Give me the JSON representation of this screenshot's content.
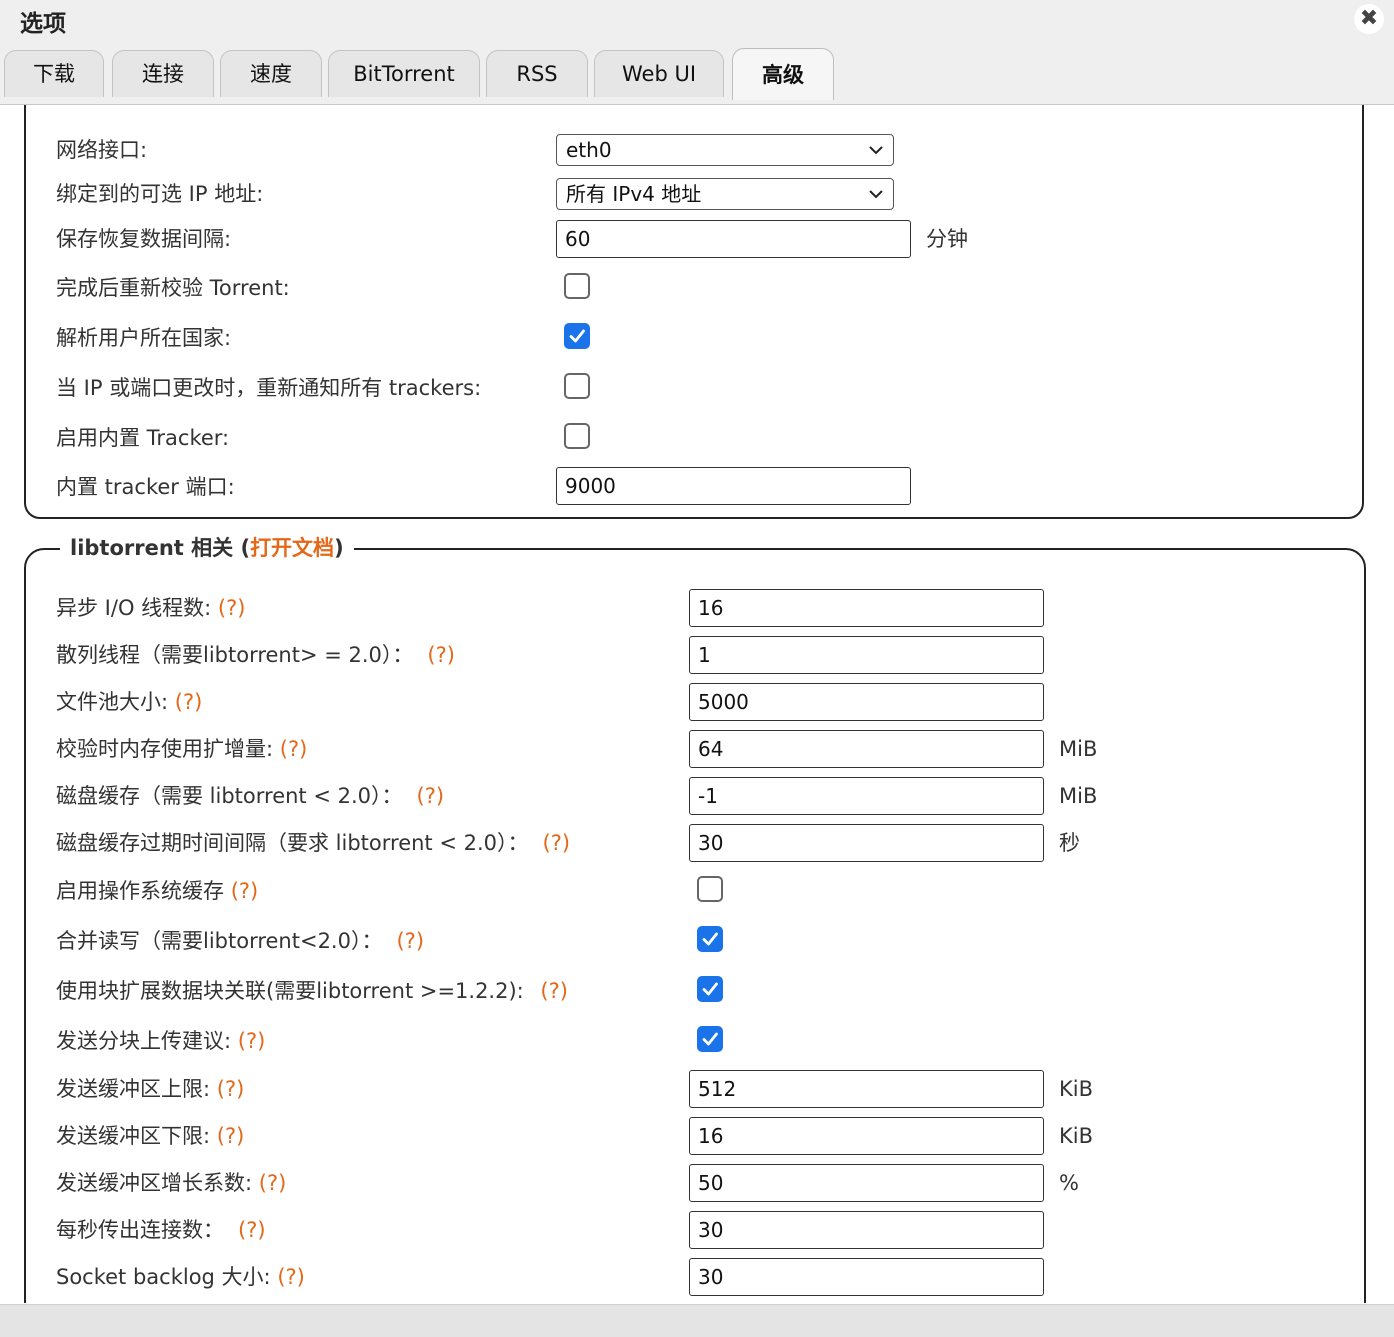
{
  "window": {
    "title": "选项",
    "close_symbol": "✖"
  },
  "tabs": [
    {
      "label": "下载"
    },
    {
      "label": "连接"
    },
    {
      "label": "速度"
    },
    {
      "label": "BitTorrent"
    },
    {
      "label": "RSS"
    },
    {
      "label": "Web UI"
    },
    {
      "label": "高级",
      "active": true
    }
  ],
  "network": {
    "interface": {
      "label": "网络接口:",
      "value": "eth0"
    },
    "bind_ip": {
      "label": "绑定到的可选 IP 地址:",
      "value": "所有 IPv4 地址"
    },
    "save_resume_interval": {
      "label": "保存恢复数据间隔:",
      "value": "60",
      "unit": "分钟"
    },
    "recheck_on_completion": {
      "label": "完成后重新校验 Torrent:",
      "checked": false
    },
    "resolve_country": {
      "label": "解析用户所在国家:",
      "checked": true
    },
    "reannounce_on_ip_change": {
      "label": "当 IP 或端口更改时，重新通知所有 trackers:",
      "checked": false
    },
    "enable_embedded_tracker": {
      "label": "启用内置 Tracker:",
      "checked": false
    },
    "embedded_tracker_port": {
      "label": "内置 tracker 端口:",
      "value": "9000"
    }
  },
  "libtorrent": {
    "legend_prefix": "libtorrent 相关 (",
    "legend_link": "打开文档",
    "legend_suffix": ")",
    "help_text": "(?)",
    "async_io_threads": {
      "label": "异步 I/O 线程数: ",
      "value": "16"
    },
    "hashing_threads": {
      "label": "散列线程（需要libtorrent> = 2.0）：",
      "value": "1"
    },
    "file_pool_size": {
      "label": "文件池大小: ",
      "value": "5000"
    },
    "checking_memory": {
      "label": "校验时内存使用扩增量: ",
      "value": "64",
      "unit": "MiB"
    },
    "disk_cache": {
      "label": "磁盘缓存（需要 libtorrent < 2.0）：",
      "value": "-1",
      "unit": "MiB"
    },
    "disk_cache_ttl": {
      "label": "磁盘缓存过期时间间隔（要求 libtorrent < 2.0）：",
      "value": "30",
      "unit": "秒"
    },
    "os_cache": {
      "label": "启用操作系统缓存 ",
      "checked": false
    },
    "coalesce_rw": {
      "label": "合并读写（需要libtorrent<2.0）：",
      "checked": true
    },
    "piece_extent_affinity": {
      "label": "使用块扩展数据块关联(需要libtorrent >=1.2.2): ",
      "checked": true
    },
    "suggest_mode": {
      "label": "发送分块上传建议: ",
      "checked": true
    },
    "send_buffer_watermark": {
      "label": "发送缓冲区上限: ",
      "value": "512",
      "unit": "KiB"
    },
    "send_buffer_low_watermark": {
      "label": "发送缓冲区下限: ",
      "value": "16",
      "unit": "KiB"
    },
    "send_buffer_factor": {
      "label": "发送缓冲区增长系数: ",
      "value": "50",
      "unit": "%"
    },
    "outgoing_connections": {
      "label": "每秒传出连接数：",
      "value": "30"
    },
    "socket_backlog": {
      "label": "Socket backlog 大小: ",
      "value": "30"
    }
  },
  "colors": {
    "accent_link": "#e3681a",
    "checkbox_checked": "#1a73e8",
    "window_chrome": "#efefef"
  }
}
